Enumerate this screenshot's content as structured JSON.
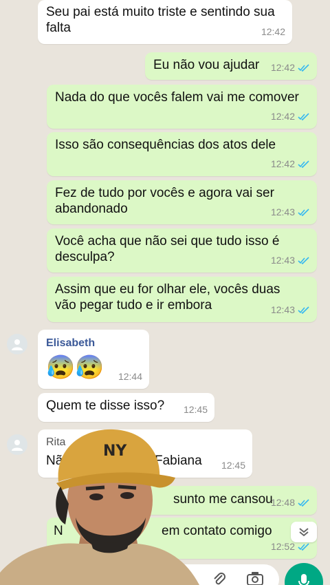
{
  "messages": [
    {
      "text": "Seu pai está muito triste e sentindo sua falta",
      "time": "12:42"
    },
    {
      "text": "Eu não vou ajudar",
      "time": "12:42"
    },
    {
      "text": "Nada do que vocês falem vai me comover",
      "time": "12:42"
    },
    {
      "text": "Isso são consequências dos atos dele",
      "time": "12:42"
    },
    {
      "text": "Fez de tudo por vocês e agora vai ser abandonado",
      "time": "12:43"
    },
    {
      "text": "Você acha que não sei que tudo isso é desculpa?",
      "time": "12:43"
    },
    {
      "text": "Assim que eu for olhar ele, vocês duas vão pegar tudo e ir embora",
      "time": "12:43"
    },
    {
      "sender": "Elisabeth",
      "emoji": "😰😰",
      "time": "12:44"
    },
    {
      "text": "Quem te disse isso?",
      "time": "12:45"
    },
    {
      "sender": "Rita",
      "text_left": "Nã",
      "text_right": "Fabiana",
      "time": "12:45"
    },
    {
      "text": "sunto me cansou",
      "time": "12:48"
    },
    {
      "text_left": "N",
      "text": "em contato comigo",
      "time": "12:52"
    }
  ],
  "icons": {
    "read_ticks": "double-check-icon",
    "scroll_down": "chevron-double-down-icon",
    "attach": "paperclip-icon",
    "camera": "camera-icon",
    "mic": "mic-icon",
    "avatar": "person-icon"
  },
  "colors": {
    "outgoing_bubble": "#dcf8c6",
    "incoming_bubble": "#ffffff",
    "read_tick": "#34b7f1",
    "mic_button": "#00a884"
  }
}
